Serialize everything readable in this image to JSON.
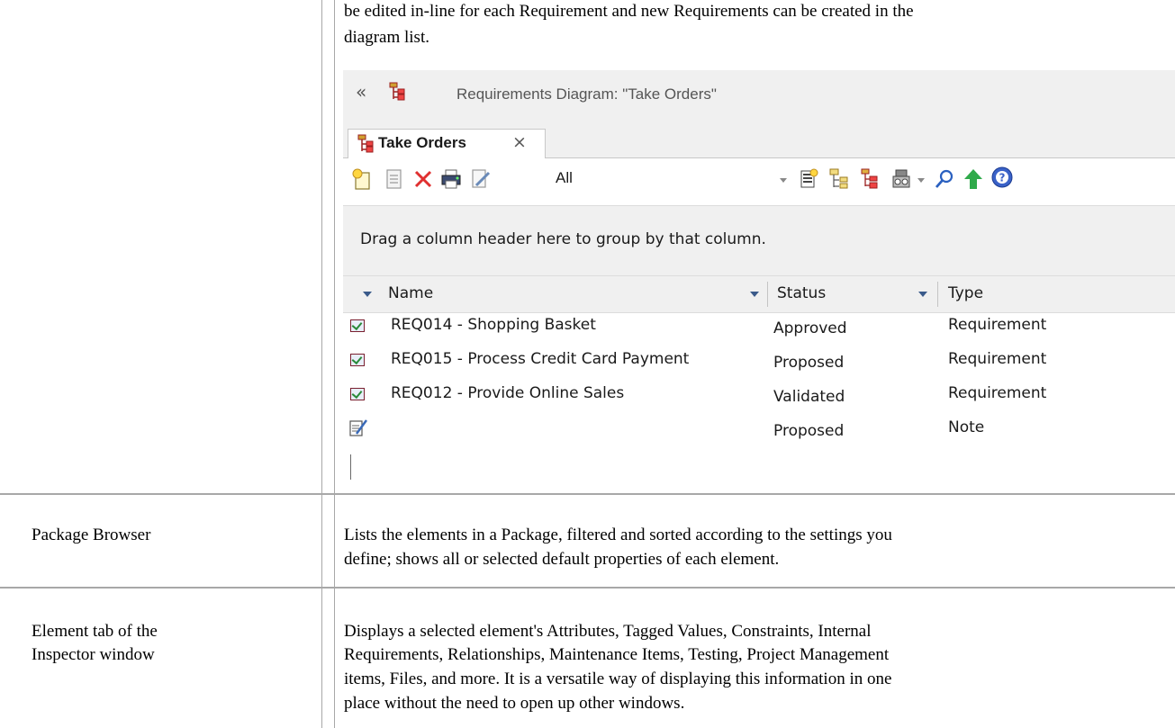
{
  "doc": {
    "intro_line1": "be edited in-line for each Requirement and new Requirements can be created in the",
    "intro_line2": "diagram list.",
    "rows": [
      {
        "term": "Package Browser",
        "desc_lines": [
          "Lists the elements in a Package, filtered and sorted according to the settings you",
          "define; shows all or selected default properties of each element."
        ]
      },
      {
        "term_lines": [
          "Element tab of the",
          "Inspector window"
        ],
        "desc_lines": [
          "Displays a selected element's Attributes, Tagged Values, Constraints, Internal",
          "Requirements, Relationships, Maintenance Items, Testing, Project Management",
          "items, Files, and more. It is a versatile way of displaying this information in one",
          "place without the need to open up other windows."
        ]
      }
    ]
  },
  "screenshot": {
    "window_title": "Requirements Diagram: \"Take Orders\"",
    "tab_label": "Take Orders",
    "tab_close": "×",
    "filter_value": "All",
    "group_hint": "Drag a column header here to group by that column.",
    "columns": [
      "Name",
      "Status",
      "Type"
    ],
    "rows": [
      {
        "icon": "requirement-icon",
        "name": "REQ014 - Shopping Basket",
        "status": "Approved",
        "type": "Requirement"
      },
      {
        "icon": "requirement-icon",
        "name": "REQ015 - Process Credit Card Payment",
        "status": "Proposed",
        "type": "Requirement"
      },
      {
        "icon": "requirement-icon",
        "name": "REQ012 - Provide Online Sales",
        "status": "Validated",
        "type": "Requirement"
      },
      {
        "icon": "note-icon",
        "name": "",
        "status": "Proposed",
        "type": "Note"
      }
    ],
    "toolbar_icons": [
      "new-element-icon",
      "properties-icon",
      "delete-icon",
      "print-icon",
      "note-edit-icon",
      "filter-dropdown-icon",
      "bulk-edit-icon",
      "tree-icon",
      "hierarchy-icon",
      "view-options-icon",
      "find-icon",
      "up-arrow-icon",
      "help-icon"
    ],
    "colors": {
      "chrome": "#f0f0f0",
      "delete": "#e03030",
      "help": "#3a62c8",
      "up_arrow": "#2faa4a"
    }
  }
}
